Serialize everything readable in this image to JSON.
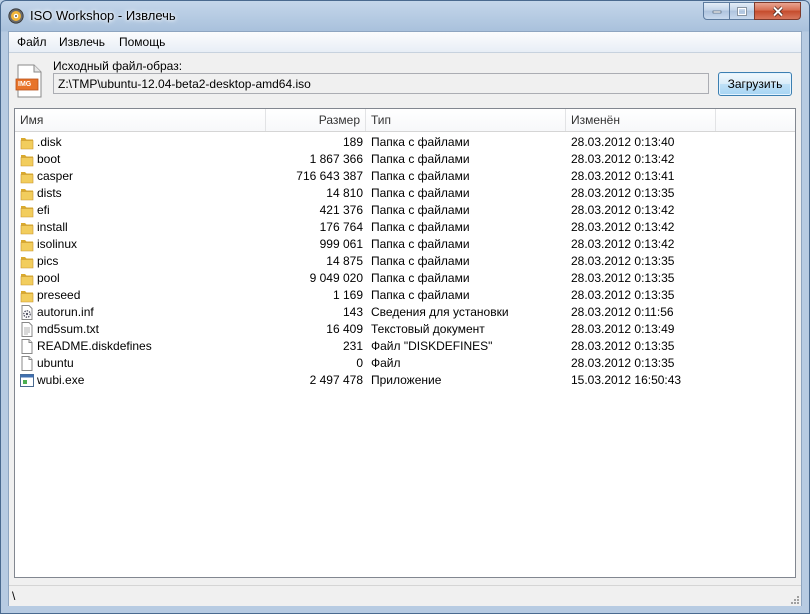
{
  "window": {
    "title": "ISO Workshop - Извлечь"
  },
  "menu": {
    "items": [
      "Файл",
      "Извлечь",
      "Помощь"
    ]
  },
  "source": {
    "label": "Исходный файл-образ:",
    "path": "Z:\\TMP\\ubuntu-12.04-beta2-desktop-amd64.iso",
    "load_button": "Загрузить",
    "icon_badge": "IMG"
  },
  "list": {
    "columns": [
      "Имя",
      "Размер",
      "Тип",
      "Изменён"
    ],
    "rows": [
      {
        "name": ".disk",
        "size": "189",
        "type": "Папка с файлами",
        "modified": "28.03.2012 0:13:40",
        "icon": "folder-icon"
      },
      {
        "name": "boot",
        "size": "1 867 366",
        "type": "Папка с файлами",
        "modified": "28.03.2012 0:13:42",
        "icon": "folder-icon"
      },
      {
        "name": "casper",
        "size": "716 643 387",
        "type": "Папка с файлами",
        "modified": "28.03.2012 0:13:41",
        "icon": "folder-icon"
      },
      {
        "name": "dists",
        "size": "14 810",
        "type": "Папка с файлами",
        "modified": "28.03.2012 0:13:35",
        "icon": "folder-icon"
      },
      {
        "name": "efi",
        "size": "421 376",
        "type": "Папка с файлами",
        "modified": "28.03.2012 0:13:42",
        "icon": "folder-icon"
      },
      {
        "name": "install",
        "size": "176 764",
        "type": "Папка с файлами",
        "modified": "28.03.2012 0:13:42",
        "icon": "folder-icon"
      },
      {
        "name": "isolinux",
        "size": "999 061",
        "type": "Папка с файлами",
        "modified": "28.03.2012 0:13:42",
        "icon": "folder-icon"
      },
      {
        "name": "pics",
        "size": "14 875",
        "type": "Папка с файлами",
        "modified": "28.03.2012 0:13:35",
        "icon": "folder-icon"
      },
      {
        "name": "pool",
        "size": "9 049 020",
        "type": "Папка с файлами",
        "modified": "28.03.2012 0:13:35",
        "icon": "folder-icon"
      },
      {
        "name": "preseed",
        "size": "1 169",
        "type": "Папка с файлами",
        "modified": "28.03.2012 0:13:35",
        "icon": "folder-icon"
      },
      {
        "name": "autorun.inf",
        "size": "143",
        "type": "Сведения для установки",
        "modified": "28.03.2012 0:11:56",
        "icon": "settings-file-icon"
      },
      {
        "name": "md5sum.txt",
        "size": "16 409",
        "type": "Текстовый документ",
        "modified": "28.03.2012 0:13:49",
        "icon": "text-file-icon"
      },
      {
        "name": "README.diskdefines",
        "size": "231",
        "type": "Файл \"DISKDEFINES\"",
        "modified": "28.03.2012 0:13:35",
        "icon": "file-icon"
      },
      {
        "name": "ubuntu",
        "size": "0",
        "type": "Файл",
        "modified": "28.03.2012 0:13:35",
        "icon": "file-icon"
      },
      {
        "name": "wubi.exe",
        "size": "2 497 478",
        "type": "Приложение",
        "modified": "15.03.2012 16:50:43",
        "icon": "app-file-icon"
      }
    ]
  },
  "status": {
    "text": "\\"
  },
  "colors": {
    "folder": "#e8c04a",
    "badge": "#e8742a",
    "accent": "#3c7fb1"
  }
}
